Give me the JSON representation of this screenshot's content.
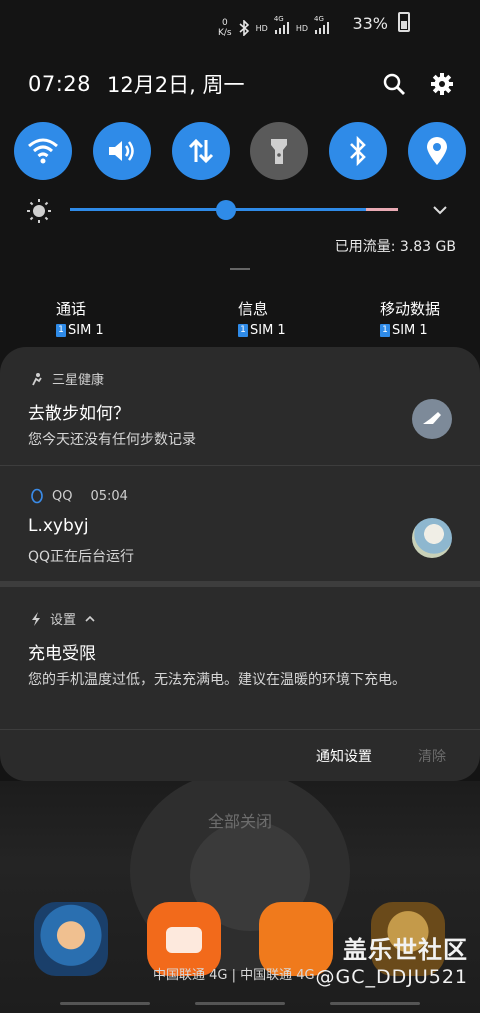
{
  "status_bar": {
    "net_speed_top": "0",
    "net_speed_unit": "K/s",
    "hd1": "HD",
    "sig1_label": "4G",
    "hd2": "HD",
    "sig2_label": "4G",
    "battery": "33%"
  },
  "header": {
    "time": "07:28",
    "date": "12月2日, 周一"
  },
  "quick_tiles": [
    {
      "name": "wifi",
      "on": true
    },
    {
      "name": "sound",
      "on": true
    },
    {
      "name": "mobile-data",
      "on": true
    },
    {
      "name": "flashlight",
      "on": false
    },
    {
      "name": "bluetooth",
      "on": true
    },
    {
      "name": "location",
      "on": true
    }
  ],
  "brightness": {
    "level": 0.52
  },
  "data_usage": "已用流量: 3.83 GB",
  "sim_row": [
    {
      "title": "通话",
      "badge": "1",
      "sim": "SIM 1"
    },
    {
      "title": "信息",
      "badge": "1",
      "sim": "SIM 1"
    },
    {
      "title": "移动数据",
      "badge": "1",
      "sim": "SIM 1"
    }
  ],
  "notifications": {
    "health": {
      "app": "三星健康",
      "title": "去散步如何？",
      "body": "您今天还没有任何步数记录"
    },
    "qq": {
      "app": "QQ",
      "time": "05:04",
      "title": "L.xybyj",
      "body": "QQ正在后台运行"
    },
    "settings": {
      "app": "设置",
      "title": "充电受限",
      "body": "您的手机温度过低，无法充满电。建议在温暖的环境下充电。"
    }
  },
  "actions": {
    "settings": "通知设置",
    "clear": "清除"
  },
  "close_all": "全部关闭",
  "carrier": "中国联通 4G | 中国联通 4G",
  "watermark": {
    "line1": "盖乐世社区",
    "line2": "@GC_DDJU521"
  },
  "colors": {
    "accent": "#2f8be8",
    "panel": "#2b2b2b",
    "background": "#141414"
  }
}
